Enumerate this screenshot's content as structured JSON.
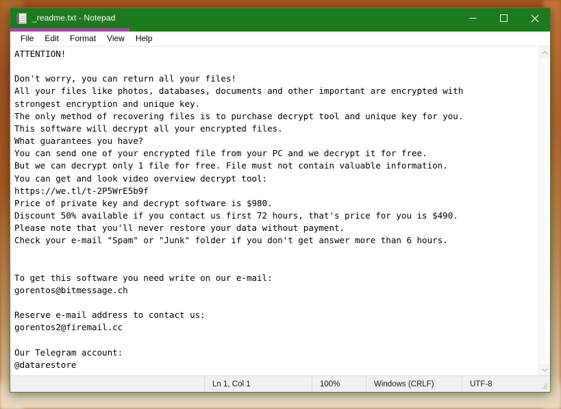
{
  "window": {
    "title": "_readme.txt - Notepad",
    "icon": "notepad-icon",
    "titlebar_color": "#1d7a1d",
    "accent_color": "#a14aa1",
    "controls": {
      "minimize": "Minimize",
      "maximize": "Maximize",
      "close": "Close"
    }
  },
  "menu": {
    "items": [
      {
        "label": "File"
      },
      {
        "label": "Edit"
      },
      {
        "label": "Format"
      },
      {
        "label": "View"
      },
      {
        "label": "Help"
      }
    ]
  },
  "document": {
    "text": "ATTENTION!\n\nDon't worry, you can return all your files!\nAll your files like photos, databases, documents and other important are encrypted with\nstrongest encryption and unique key.\nThe only method of recovering files is to purchase decrypt tool and unique key for you.\nThis software will decrypt all your encrypted files.\nWhat guarantees you have?\nYou can send one of your encrypted file from your PC and we decrypt it for free.\nBut we can decrypt only 1 file for free. File must not contain valuable information.\nYou can get and look video overview decrypt tool:\nhttps://we.tl/t-2P5WrE5b9f\nPrice of private key and decrypt software is $980.\nDiscount 50% available if you contact us first 72 hours, that's price for you is $490.\nPlease note that you'll never restore your data without payment.\nCheck your e-mail \"Spam\" or \"Junk\" folder if you don't get answer more than 6 hours.\n\n\nTo get this software you need write on our e-mail:\ngorentos@bitmessage.ch\n\nReserve e-mail address to contact us:\ngorentos2@firemail.cc\n\nOur Telegram account:\n@datarestore",
    "lines": [
      "ATTENTION!",
      "",
      "Don't worry, you can return all your files!",
      "All your files like photos, databases, documents and other important are encrypted with",
      "strongest encryption and unique key.",
      "The only method of recovering files is to purchase decrypt tool and unique key for you.",
      "This software will decrypt all your encrypted files.",
      "What guarantees you have?",
      "You can send one of your encrypted file from your PC and we decrypt it for free.",
      "But we can decrypt only 1 file for free. File must not contain valuable information.",
      "You can get and look video overview decrypt tool:",
      "https://we.tl/t-2P5WrE5b9f",
      "Price of private key and decrypt software is $980.",
      "Discount 50% available if you contact us first 72 hours, that's price for you is $490.",
      "Please note that you'll never restore your data without payment.",
      "Check your e-mail \"Spam\" or \"Junk\" folder if you don't get answer more than 6 hours.",
      "",
      "",
      "To get this software you need write on our e-mail:",
      "gorentos@bitmessage.ch",
      "",
      "Reserve e-mail address to contact us:",
      "gorentos2@firemail.cc",
      "",
      "Our Telegram account:",
      "@datarestore"
    ],
    "decrypt_tool_url": "https://we.tl/t-2P5WrE5b9f",
    "price": "$980",
    "discount_price": "$490",
    "discount_percent": "50%",
    "discount_window_hours": "72 hours",
    "answer_wait_hours": "6 hours",
    "email_primary": "gorentos@bitmessage.ch",
    "email_reserve": "gorentos2@firemail.cc",
    "telegram": "@datarestore"
  },
  "scrollbar": {
    "up_arrow": "chevron-up-icon",
    "down_arrow": "chevron-down-icon"
  },
  "status_bar": {
    "position": "Ln 1, Col 1",
    "zoom": "100%",
    "line_ending": "Windows (CRLF)",
    "encoding": "UTF-8"
  }
}
